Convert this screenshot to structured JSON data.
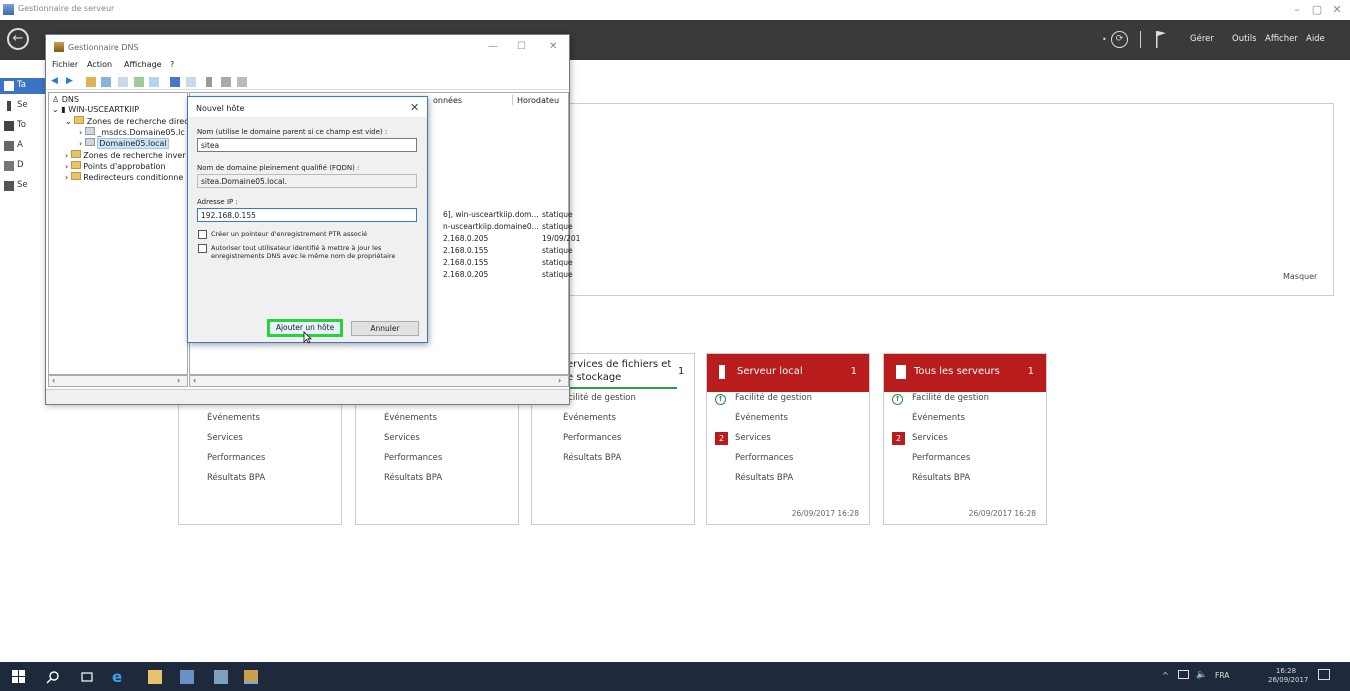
{
  "window": {
    "title": "Gestionnaire de serveur",
    "controls": [
      "–",
      "▢",
      "✕"
    ]
  },
  "header": {
    "menu": [
      "Gérer",
      "Outils",
      "Afficher",
      "Aide"
    ]
  },
  "nav": {
    "items": [
      {
        "label": "Ta",
        "icon": "dashboard-icon"
      },
      {
        "label": "Se",
        "icon": "server-icon"
      },
      {
        "label": "To",
        "icon": "servers-icon"
      },
      {
        "label": "A",
        "icon": "ad-icon"
      },
      {
        "label": "D",
        "icon": "dns-icon"
      },
      {
        "label": "Se",
        "icon": "storage-icon"
      }
    ]
  },
  "dashboard": {
    "hide_label": "Masquer",
    "tiles": [
      {
        "title": "",
        "count": "",
        "rows": [
          "Événements",
          "Services",
          "Performances",
          "Résultats BPA"
        ],
        "date": ""
      },
      {
        "title": "",
        "count": "",
        "rows": [
          "Événements",
          "Services",
          "Performances",
          "Résultats BPA"
        ],
        "date": ""
      },
      {
        "title": "ervices de fichiers et",
        "title2": "e stockage",
        "count": "1",
        "rows": [
          "acilité de gestion",
          "Événements",
          "Performances",
          "Résultats BPA"
        ],
        "date": ""
      },
      {
        "title": "Serveur local",
        "count": "1",
        "rows": [
          "Facilité de gestion",
          "Événements",
          "Services",
          "Performances",
          "Résultats BPA"
        ],
        "services_badge": "2",
        "date": "26/09/2017 16:28"
      },
      {
        "title": "Tous les serveurs",
        "count": "1",
        "rows": [
          "Facilité de gestion",
          "Événements",
          "Services",
          "Performances",
          "Résultats BPA"
        ],
        "services_badge": "2",
        "date": "26/09/2017 16:28"
      }
    ]
  },
  "dns": {
    "title": "Gestionnaire DNS",
    "controls": [
      "—",
      "☐",
      "✕"
    ],
    "menu": [
      "Fichier",
      "Action",
      "Affichage",
      "?"
    ],
    "tree": [
      {
        "label": "DNS",
        "level": 0
      },
      {
        "label": "WIN-USCEARTKIIP",
        "level": 1
      },
      {
        "label": "Zones de recherche direc",
        "level": 2
      },
      {
        "label": "_msdcs.Domaine05.lc",
        "level": 3
      },
      {
        "label": "Domaine05.local",
        "level": 3,
        "selected": true
      },
      {
        "label": "Zones de recherche inver",
        "level": 2
      },
      {
        "label": "Points d'approbation",
        "level": 2
      },
      {
        "label": "Redirecteurs conditionne",
        "level": 2
      }
    ],
    "list_headers": [
      "onnées",
      "Horodateu"
    ],
    "list_rows": [
      {
        "data": "6], win-usceartkiip.dom...",
        "ts": "statique"
      },
      {
        "data": "n-usceartkiip.domaine0...",
        "ts": "statique"
      },
      {
        "data": "2.168.0.205",
        "ts": "19/09/201"
      },
      {
        "data": "2.168.0.155",
        "ts": "statique"
      },
      {
        "data": "2.168.0.155",
        "ts": "statique"
      },
      {
        "data": "2.168.0.205",
        "ts": "statique"
      }
    ]
  },
  "dialog": {
    "title": "Nouvel hôte",
    "close": "✕",
    "name_label": "Nom (utilise le domaine parent si ce champ est vide) :",
    "name_value": "sitea",
    "fqdn_label": "Nom de domaine pleinement qualifié (FQDN) :",
    "fqdn_value": "sitea.Domaine05.local.",
    "ip_label": "Adresse IP :",
    "ip_value": "192.168.0.155",
    "chk_ptr": "Créer un pointeur d'enregistrement PTR associé",
    "chk_auth": "Autoriser tout utilisateur identifié à mettre à jour les enregistrements DNS avec le même nom de propriétaire",
    "add_button": "Ajouter un hôte",
    "cancel_button": "Annuler"
  },
  "taskbar": {
    "lang": "FRA",
    "time": "16:28",
    "date": "26/09/2017"
  }
}
